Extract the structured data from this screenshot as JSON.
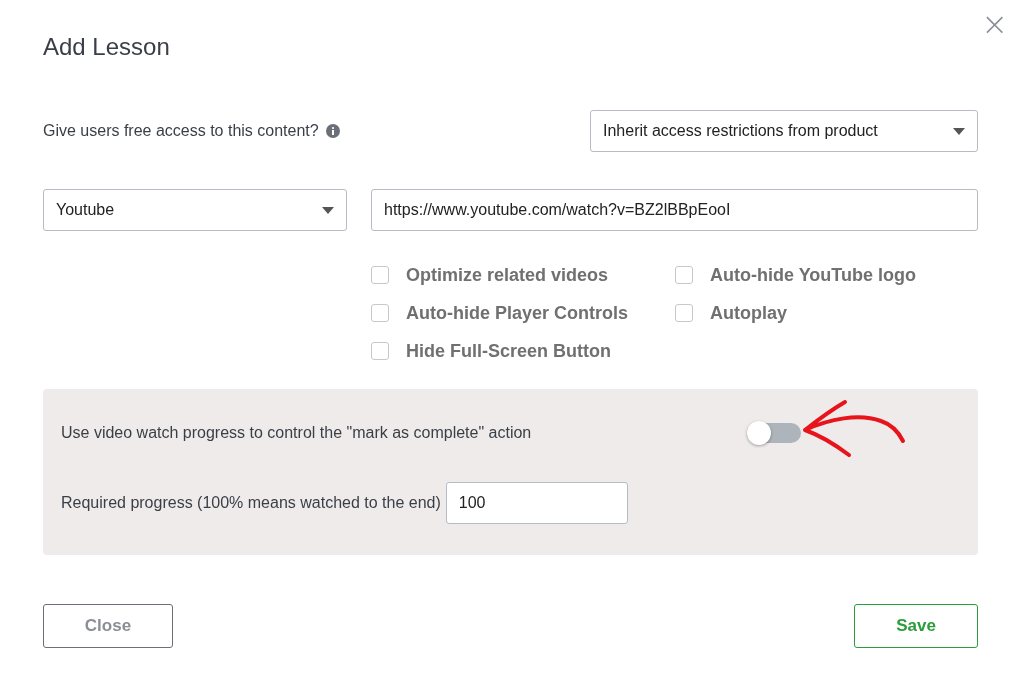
{
  "dialog": {
    "title": "Add Lesson",
    "close_icon": "×"
  },
  "access": {
    "label": "Give users free access to this content?",
    "select_value": "Inherit access restrictions from product"
  },
  "video": {
    "source_value": "Youtube",
    "url_value": "https://www.youtube.com/watch?v=BZ2lBBpEooI"
  },
  "options": [
    {
      "label": "Optimize related videos",
      "checked": false
    },
    {
      "label": "Auto-hide YouTube logo",
      "checked": false
    },
    {
      "label": "Auto-hide Player Controls",
      "checked": false
    },
    {
      "label": "Autoplay",
      "checked": false
    },
    {
      "label": "Hide Full-Screen Button",
      "checked": false
    }
  ],
  "progress_panel": {
    "toggle_label": "Use video watch progress to control the \"mark as complete\" action",
    "toggle_on": false,
    "required_label": "Required progress (100% means watched to the end)",
    "required_value": "100"
  },
  "buttons": {
    "close": "Close",
    "save": "Save"
  }
}
